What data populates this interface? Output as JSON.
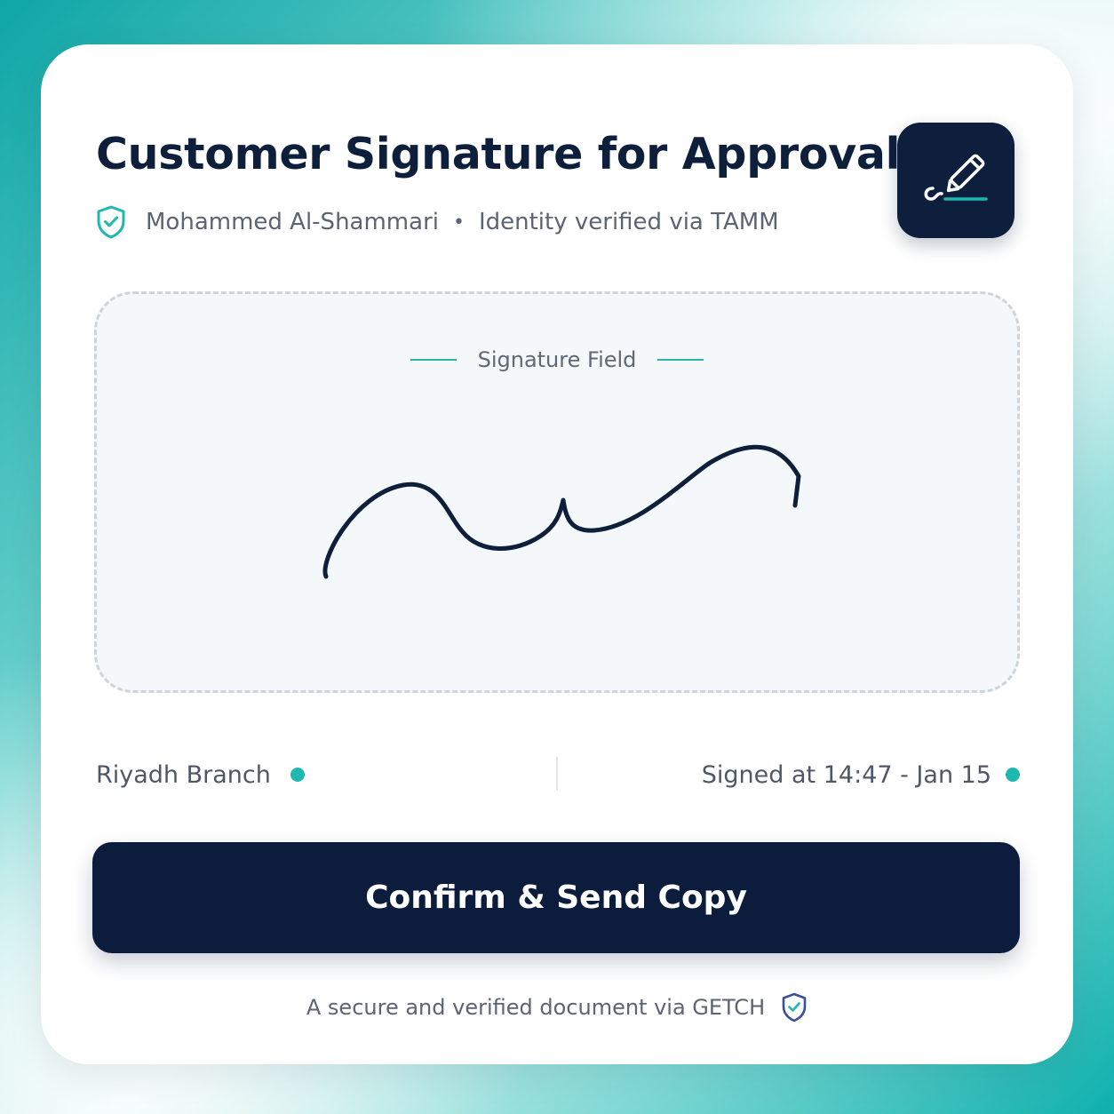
{
  "header": {
    "title": "Customer Signature for Approval",
    "signer_name": "Mohammed Al-Shammari",
    "separator": "•",
    "verification": "Identity verified via TAMM",
    "verified_icon": "shield-check-icon",
    "action_icon": "pen-signature-icon"
  },
  "signature": {
    "label": "Signature Field"
  },
  "meta": {
    "branch": "Riyadh Branch",
    "signed_at": "Signed at 14:47 - Jan 15"
  },
  "actions": {
    "confirm_label": "Confirm & Send Copy"
  },
  "footer": {
    "text": "A secure and verified document via GETCH",
    "icon": "shield-check-icon"
  },
  "colors": {
    "navy": "#0b1c3d",
    "teal": "#1fb8b0",
    "footer_shield": "#3a4f9a"
  }
}
